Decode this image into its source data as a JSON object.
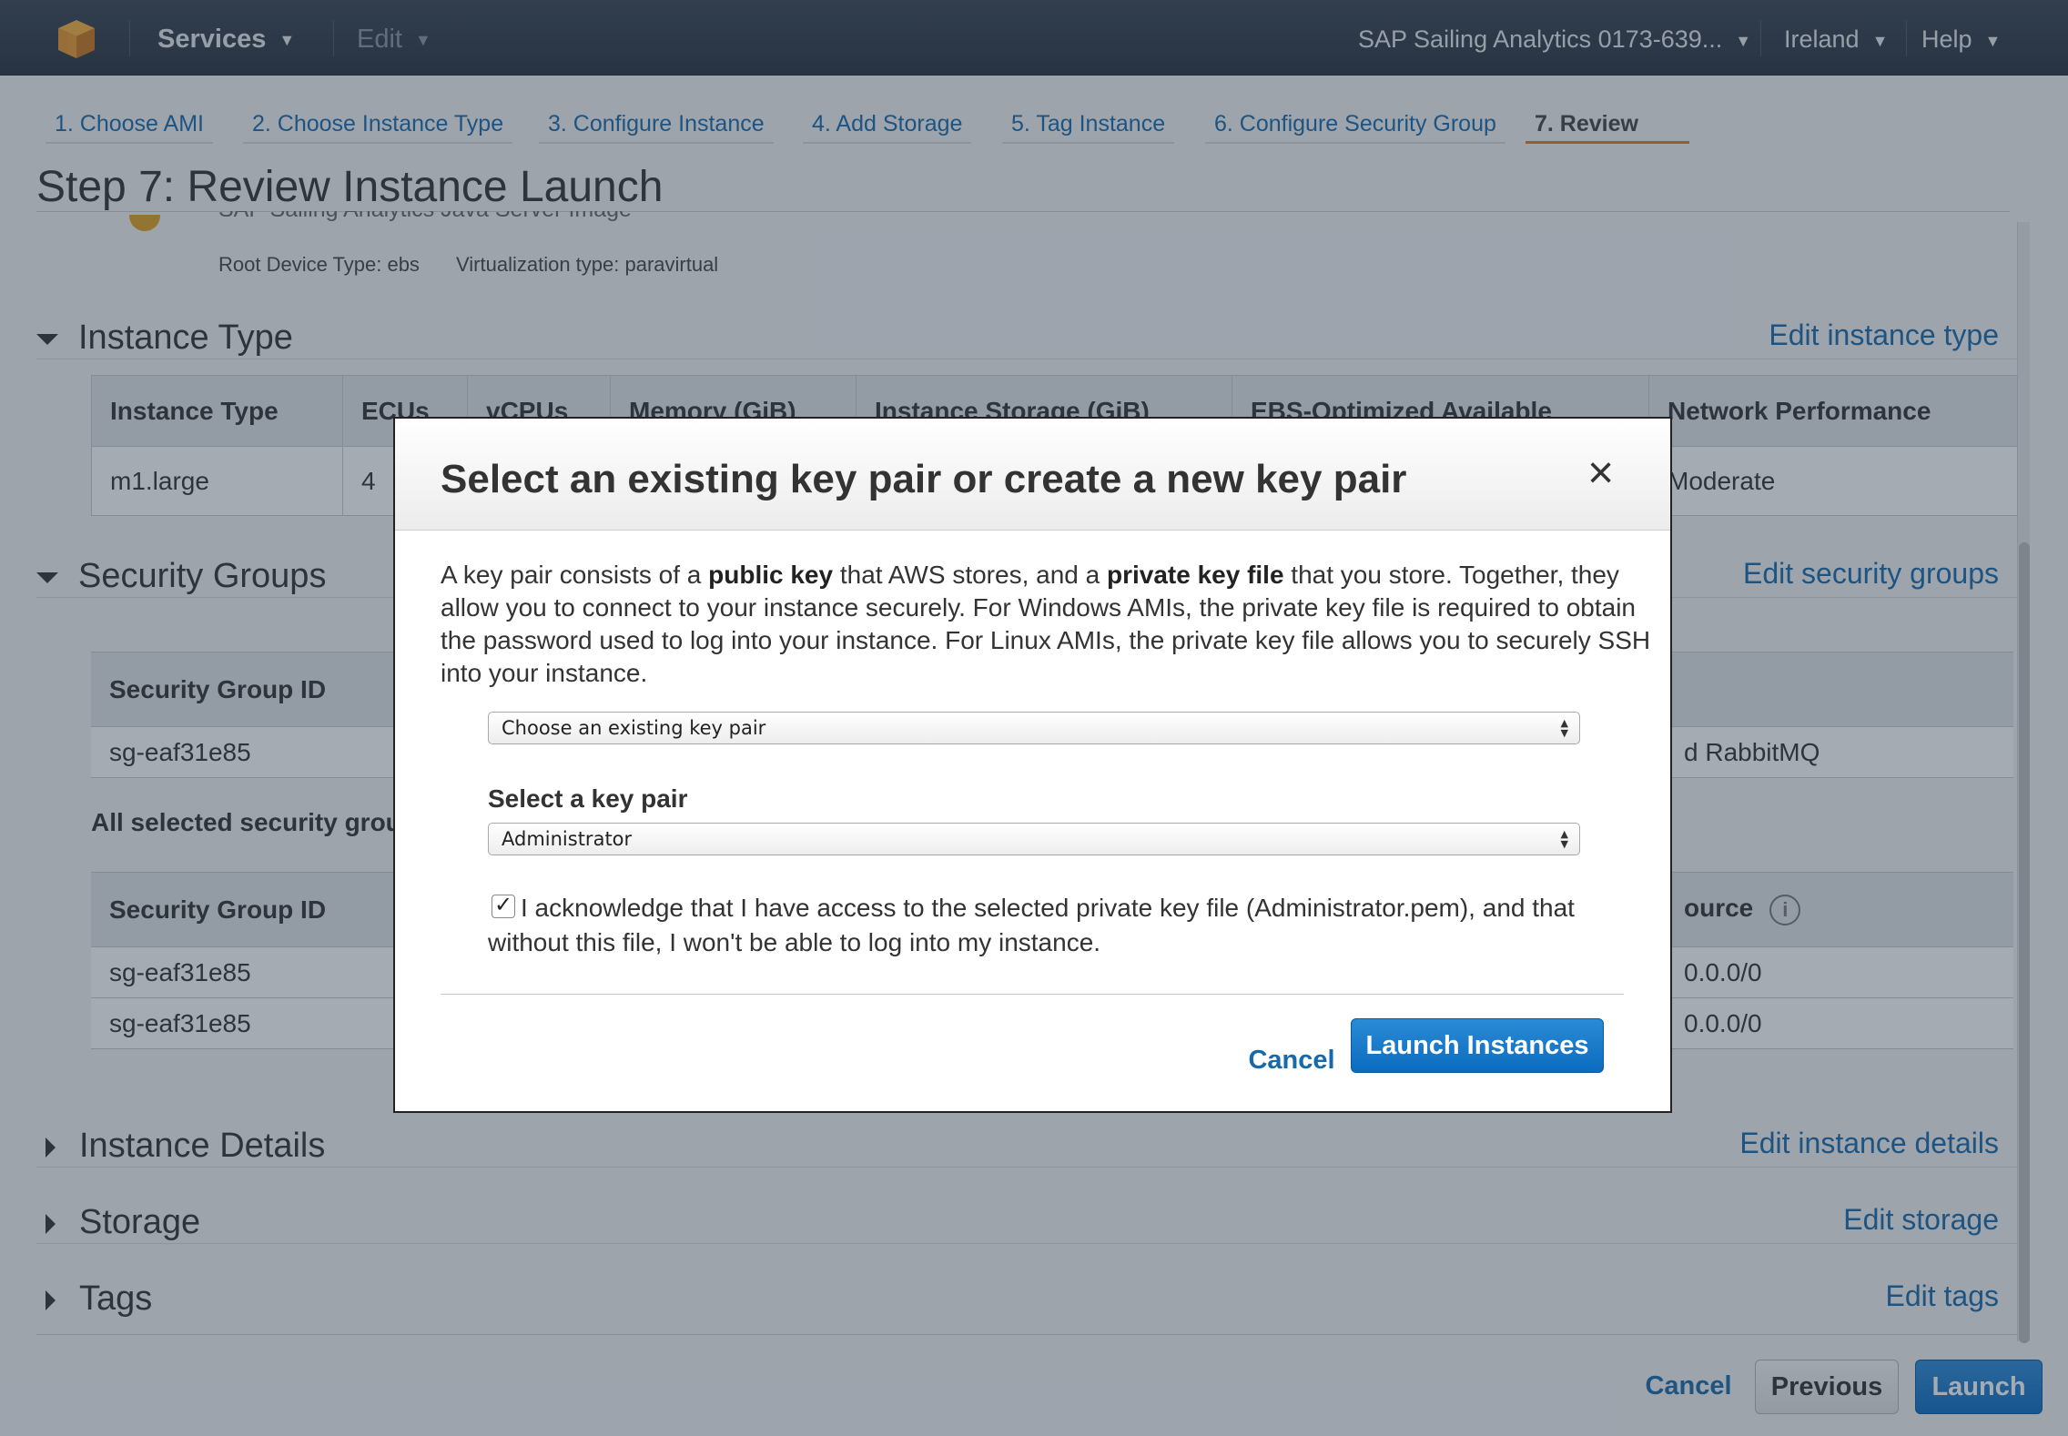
{
  "topbar": {
    "services": "Services",
    "edit": "Edit",
    "account": "SAP Sailing Analytics 0173-639...",
    "region": "Ireland",
    "help": "Help"
  },
  "steps": [
    "1. Choose AMI",
    "2. Choose Instance Type",
    "3. Configure Instance",
    "4. Add Storage",
    "5. Tag Instance",
    "6. Configure Security Group",
    "7. Review"
  ],
  "page_title": "Step 7: Review Instance Launch",
  "ami": {
    "name_partial": "SAP Sailing Analytics Java Server Image",
    "root_device": "Root Device Type: ebs",
    "virtualization": "Virtualization type: paravirtual"
  },
  "instance_type": {
    "heading": "Instance Type",
    "edit": "Edit instance type",
    "columns": [
      "Instance Type",
      "ECUs",
      "vCPUs",
      "Memory (GiB)",
      "Instance Storage (GiB)",
      "EBS-Optimized Available",
      "Network Performance"
    ],
    "row": [
      "m1.large",
      "4",
      "",
      "",
      "",
      "",
      "Moderate"
    ]
  },
  "security_groups": {
    "heading": "Security Groups",
    "edit": "Edit security groups",
    "col_id": "Security Group ID",
    "row1_id": "sg-eaf31e85",
    "row1_desc": "d RabbitMQ",
    "note": "All selected security grou",
    "col_source": "ource",
    "rules": [
      {
        "id": "sg-eaf31e85",
        "source": "0.0.0/0"
      },
      {
        "id": "sg-eaf31e85",
        "source": "0.0.0/0"
      }
    ]
  },
  "collapsed_sections": [
    {
      "heading": "Instance Details",
      "edit": "Edit instance details"
    },
    {
      "heading": "Storage",
      "edit": "Edit storage"
    },
    {
      "heading": "Tags",
      "edit": "Edit tags"
    }
  ],
  "footer": {
    "cancel": "Cancel",
    "previous": "Previous",
    "launch": "Launch"
  },
  "modal": {
    "title": "Select an existing key pair or create a new key pair",
    "close": "×",
    "desc_1": "A key pair consists of a ",
    "desc_b1": "public key",
    "desc_2": " that AWS stores, and a ",
    "desc_b2": "private key file",
    "desc_3": " that you store. Together, they allow you to connect to your instance securely. For Windows AMIs, the private key file is required to obtain the password used to log into your instance. For Linux AMIs, the private key file allows you to securely SSH into your instance.",
    "mode_select": "Choose an existing key pair",
    "key_label": "Select a key pair",
    "key_select": "Administrator",
    "ack_checked": "✓",
    "ack_text": "I acknowledge that I have access to the selected private key file (Administrator.pem), and that without this file, I won't be able to log into my instance.",
    "cancel": "Cancel",
    "launch": "Launch Instances"
  },
  "colors": {
    "link": "#1769aa",
    "primary_button": "#0b6bbf",
    "active_step_underline": "#e07a1f",
    "topbar": "#28323d"
  }
}
